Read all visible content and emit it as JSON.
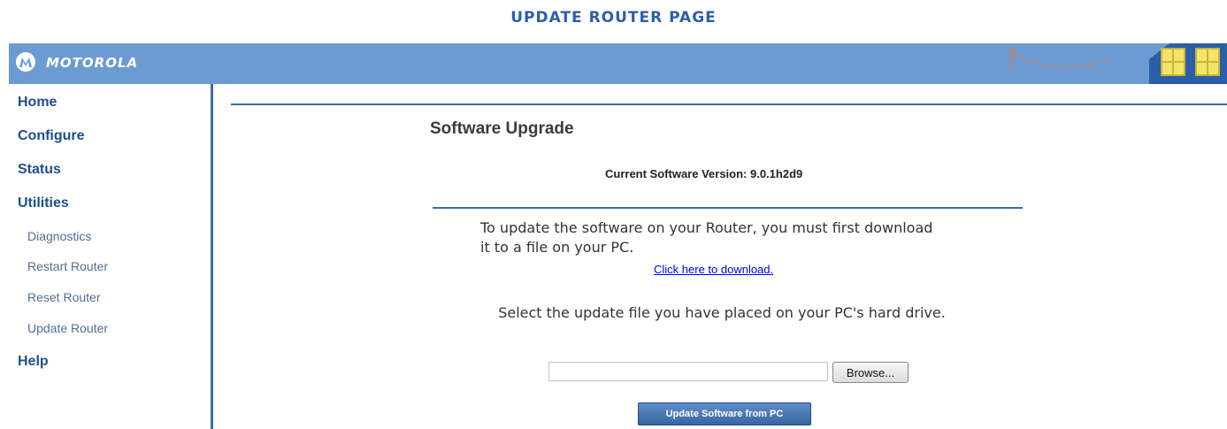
{
  "page_heading": "UPDATE ROUTER PAGE",
  "brand": {
    "logo_icon": "motorola-batwing-logo",
    "name": "MOTOROLA"
  },
  "sidebar": {
    "items": [
      {
        "label": "Home",
        "level": "main"
      },
      {
        "label": "Configure",
        "level": "main"
      },
      {
        "label": "Status",
        "level": "main"
      },
      {
        "label": "Utilities",
        "level": "main"
      },
      {
        "label": "Diagnostics",
        "level": "sub"
      },
      {
        "label": "Restart Router",
        "level": "sub"
      },
      {
        "label": "Reset Router",
        "level": "sub"
      },
      {
        "label": "Update Router",
        "level": "sub"
      },
      {
        "label": "Help",
        "level": "main"
      }
    ]
  },
  "main": {
    "section_title": "Software Upgrade",
    "current_version": "Current Software Version: 9.0.1h2d9",
    "instruction_download": "To update the software on your Router, you must first download it to a file on your PC.",
    "download_link": "Click here to download.",
    "instruction_select": "Select the update file you have placed on your PC's hard drive.",
    "file_input_value": "",
    "browse_label": "Browse...",
    "update_button_label": "Update Software from PC"
  },
  "colors": {
    "header_bar": "#6c9bd3",
    "accent_dark": "#3a6ea5",
    "heading_blue": "#2f5ea8",
    "nav_text": "#1f4e8c"
  }
}
